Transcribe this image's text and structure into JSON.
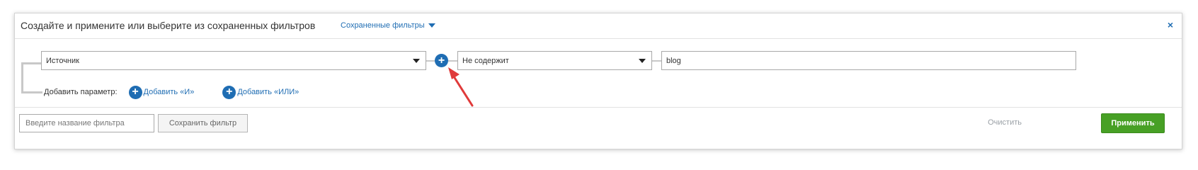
{
  "header": {
    "title": "Создайте и примените или выберите из сохраненных фильтров",
    "saved_filters_label": "Сохраненные фильтры",
    "close_glyph": "×"
  },
  "filter_row": {
    "parameter_value": "Источник",
    "condition_value": "Не содержит",
    "text_value": "blog"
  },
  "add_row": {
    "label": "Добавить параметр:",
    "and_label": "Добавить «И»",
    "or_label": "Добавить «ИЛИ»"
  },
  "footer": {
    "name_placeholder": "Введите название фильтра",
    "save_label": "Сохранить фильтр",
    "clear_label": "Очистить",
    "apply_label": "Применить"
  },
  "icons": {
    "plus": "+",
    "annotation_arrow_color": "#e03a3a"
  },
  "colors": {
    "accent": "#1f6db3",
    "apply": "#47a025"
  }
}
